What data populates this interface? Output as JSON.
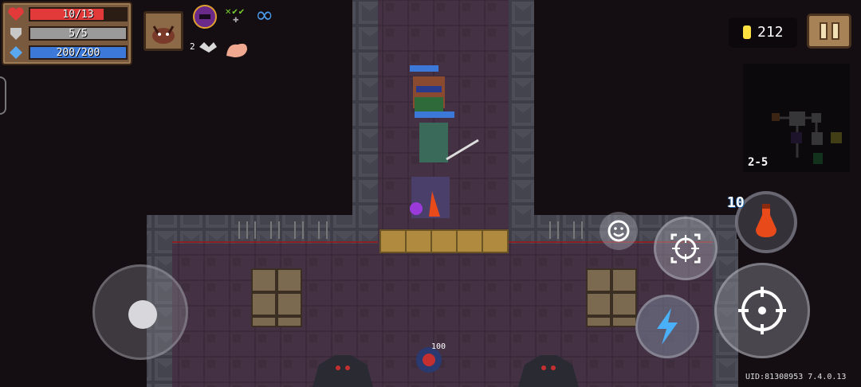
{
  "hud": {
    "health": {
      "label": "10/13",
      "current": 10,
      "max": 13,
      "color": "#e23a3a"
    },
    "armor": {
      "label": "5/5",
      "current": 5,
      "max": 5,
      "color": "#9a9a9a"
    },
    "energy": {
      "label": "200/200",
      "current": 200,
      "max": 200,
      "color": "#3b78d8"
    },
    "infinity_symbol": "∞",
    "buff_count_label": "2"
  },
  "currency": {
    "coins": "212",
    "coin_color": "#ffe040"
  },
  "minimap": {
    "level": "2-5"
  },
  "controls": {
    "weapon_energy_cost": "10",
    "ammo_pickup_label": "100"
  },
  "footer": {
    "uid": "UID:81308953 7.4.0.13"
  },
  "icons": [
    "heart-icon",
    "shield-icon",
    "diamond-icon",
    "pause-icon",
    "coin-icon",
    "smiley-icon",
    "crosshair-icon",
    "lightning-icon",
    "target-icon",
    "potion-icon",
    "flex-arm-icon",
    "helmet-icon"
  ]
}
